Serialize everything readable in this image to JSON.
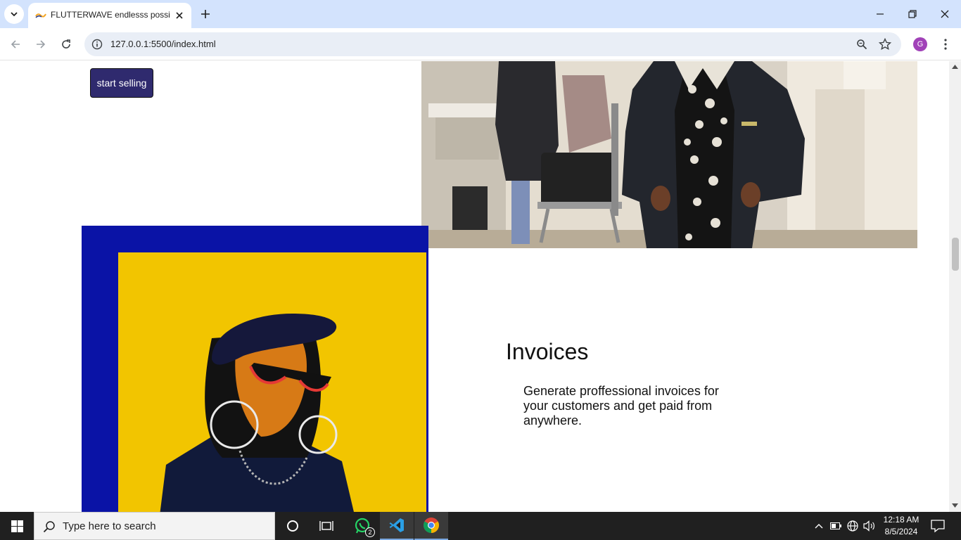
{
  "browser": {
    "tab_title": "FLUTTERWAVE endlesss possibi",
    "url": "127.0.0.1:5500/index.html",
    "profile_initial": "G"
  },
  "page": {
    "start_button_label": "start selling",
    "invoices": {
      "title": "Invoices",
      "description": "Generate proffessional invoices for your customers and get paid from anywhere."
    }
  },
  "taskbar": {
    "search_placeholder": "Type here to search",
    "whatsapp_badge": "2",
    "time": "12:18 AM",
    "date": "8/5/2024"
  },
  "colors": {
    "tab_strip": "#d3e3fd",
    "button": "#2f2a6e",
    "art_background": "#0a13a6",
    "art_panel": "#f2c500"
  }
}
